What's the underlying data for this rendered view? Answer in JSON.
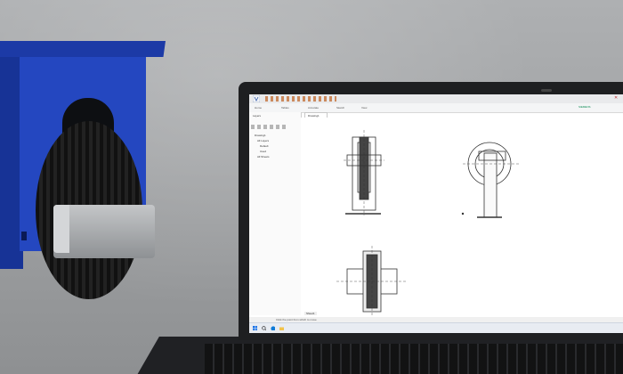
{
  "scene": {
    "floor_color": "#a2a4a6",
    "caster_color": "#2447c0",
    "clamp_color": "#b4b6b8",
    "laptop_color": "#1e1f21"
  },
  "cad_app": {
    "title": "",
    "brand": "SIEMENS",
    "ribbon_tabs": [
      "Home",
      "Tables",
      "Annotate",
      "Sketch",
      "View"
    ],
    "panel_title": "Layers",
    "tree_items": [
      "Drawing1",
      "All Layers",
      "Default",
      "Used",
      "All Sheets"
    ],
    "doc_tab_label": "Drawing1",
    "sheet_tab_label": "Sheet1",
    "status_text": "Click the point from which to move",
    "accent_color": "#0a8a52",
    "icons": [
      "app-menu-icon",
      "save-icon",
      "undo-icon",
      "redo-icon",
      "close-icon",
      "windows-start-icon",
      "search-icon",
      "browser-icon",
      "folder-icon"
    ]
  }
}
